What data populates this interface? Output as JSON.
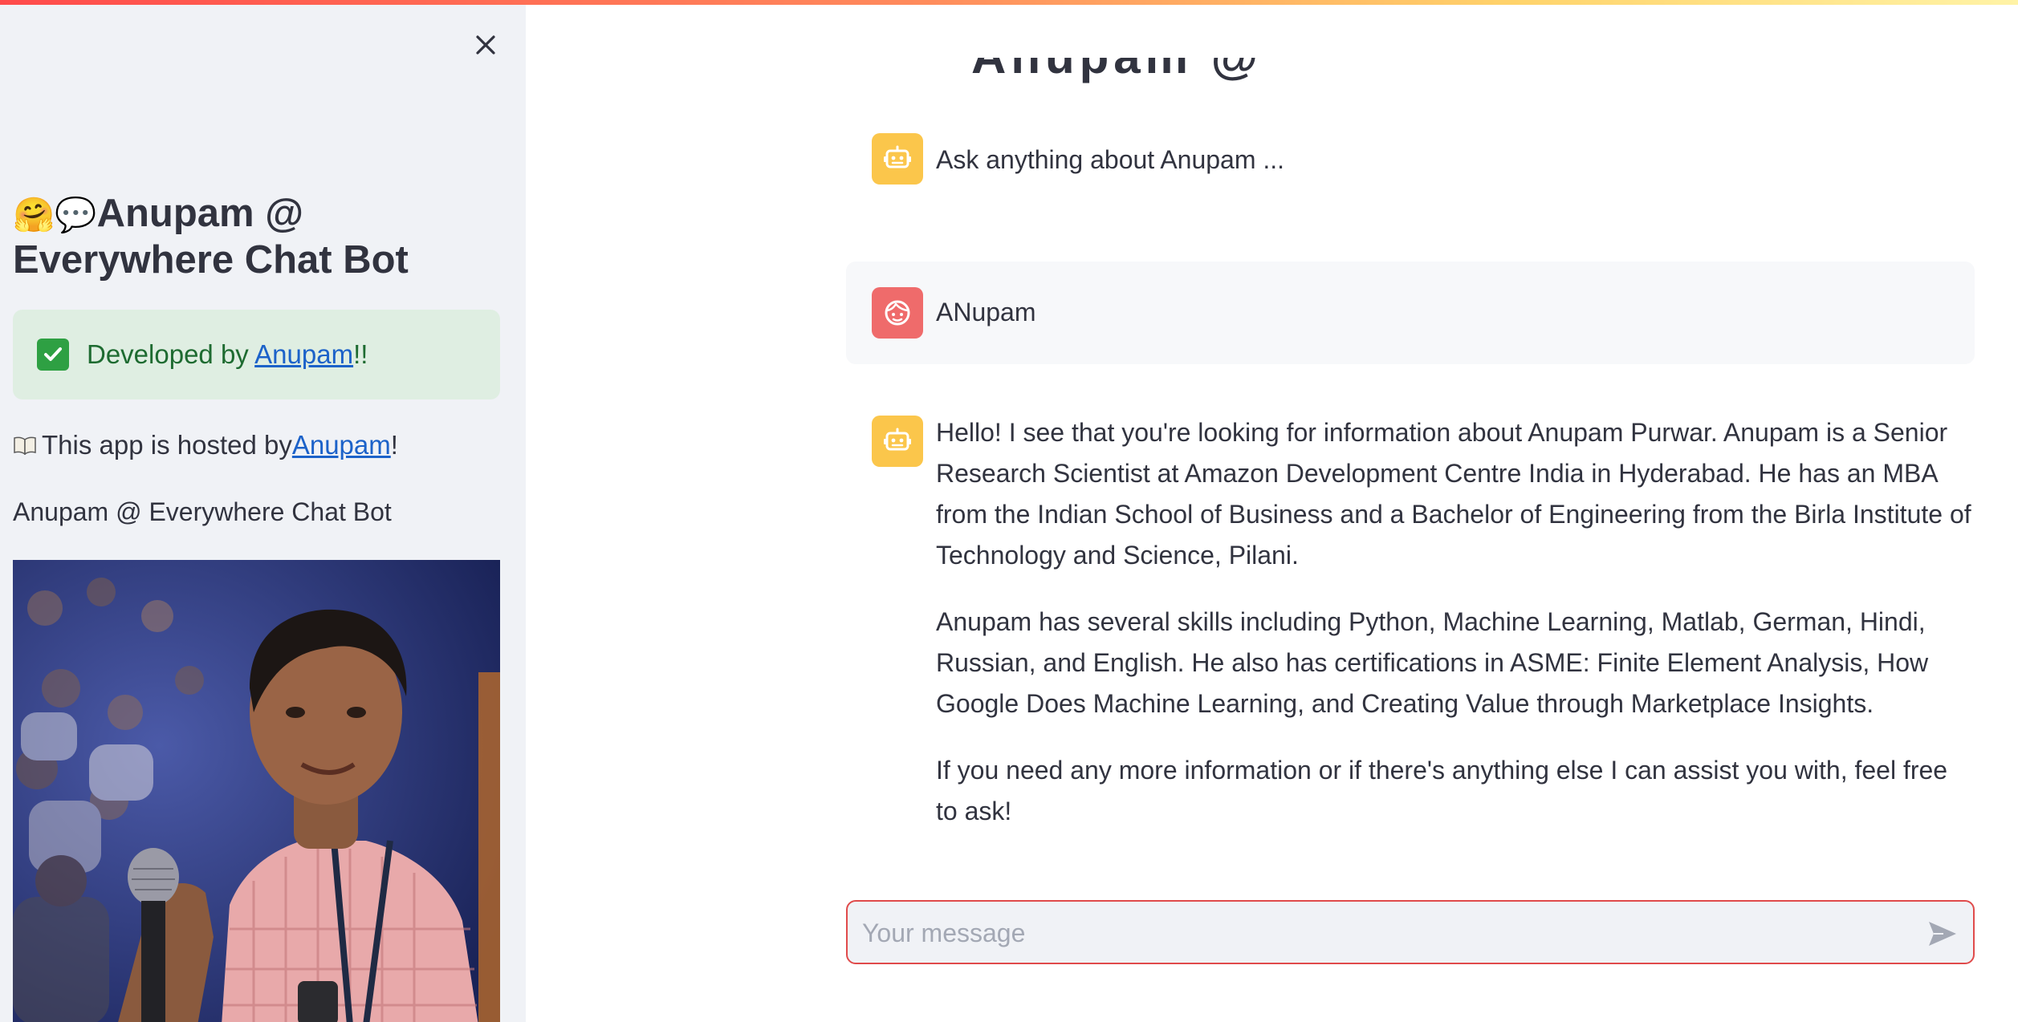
{
  "sidebar": {
    "title_emoji": "🤗💬",
    "title": "Anupam @ Everywhere Chat Bot",
    "success": {
      "prefix": "Developed by ",
      "link": "Anupam",
      "suffix": "!!"
    },
    "hosted": {
      "prefix": "This app is hosted by ",
      "link": "Anupam",
      "suffix": "!"
    },
    "caption": "Anupam @ Everywhere Chat Bot"
  },
  "chat": {
    "messages": [
      {
        "role": "assistant",
        "text": "Ask anything about Anupam ..."
      },
      {
        "role": "user",
        "text": "ANupam"
      },
      {
        "role": "assistant",
        "paragraphs": [
          "Hello! I see that you're looking for information about Anupam Purwar. Anupam is a Senior Research Scientist at Amazon Development Centre India in Hyderabad. He has an MBA from the Indian School of Business and a Bachelor of Engineering from the Birla Institute of Technology and Science, Pilani.",
          "Anupam has several skills including Python, Machine Learning, Matlab, German, Hindi, Russian, and English. He also has certifications in ASME: Finite Element Analysis, How Google Does Machine Learning, and Creating Value through Marketplace Insights.",
          "If you need any more information or if there's anything else I can assist you with, feel free to ask!"
        ]
      }
    ],
    "input": {
      "placeholder": "Your message",
      "value": ""
    }
  },
  "icons": {
    "close": "close-icon",
    "check": "check-icon",
    "book": "book-icon",
    "bot": "bot-icon",
    "user": "user-face-icon",
    "send": "send-icon"
  },
  "colors": {
    "accent": "#ff4b4b",
    "sidebar_bg": "#f0f2f6",
    "success_bg": "#dfeee2",
    "success_text": "#1e6b31",
    "link": "#1c62c9",
    "bot_avatar": "#fbc64b",
    "user_avatar": "#ef6b6b"
  }
}
